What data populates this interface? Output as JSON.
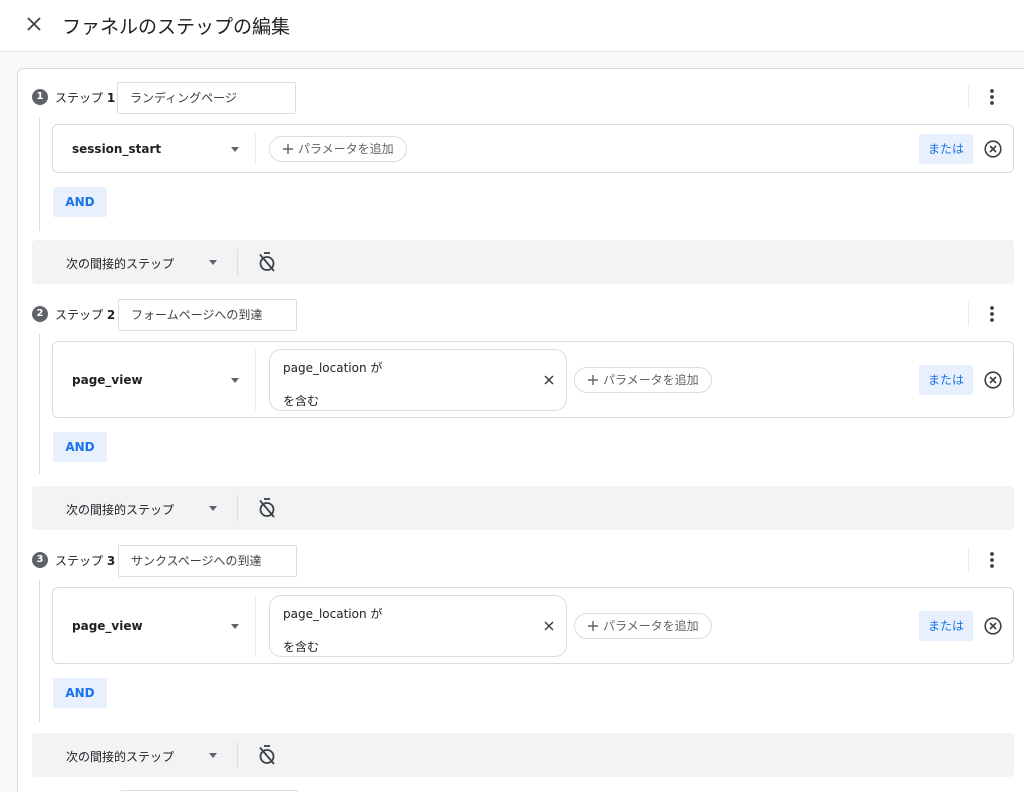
{
  "header": {
    "title": "ファネルのステップの編集",
    "close_icon": "close-icon"
  },
  "labels": {
    "add_param": "パラメータを追加",
    "or": "または",
    "and": "AND",
    "indirect": "次の間接的ステップ"
  },
  "steps": [
    {
      "number": "1",
      "label_prefix": "ステップ",
      "label_number": "1",
      "name": "ランディングページ",
      "event": "session_start"
    },
    {
      "number": "2",
      "label_prefix": "ステップ",
      "label_number": "2",
      "name": "フォームページへの到達",
      "event": "page_view",
      "filter": {
        "param": "page_location",
        "connector": "が",
        "operator": "を含む"
      }
    },
    {
      "number": "3",
      "label_prefix": "ステップ",
      "label_number": "3",
      "name": "サンクスページへの到達",
      "event": "page_view",
      "filter": {
        "param": "page_location",
        "connector": "が",
        "operator": "を含む"
      }
    }
  ],
  "colors": {
    "accent": "#1a73e8",
    "accent_bg": "#e8f0fe",
    "border": "#dadce0",
    "bar_bg": "#f1f3f4",
    "icon": "#5f6368"
  }
}
